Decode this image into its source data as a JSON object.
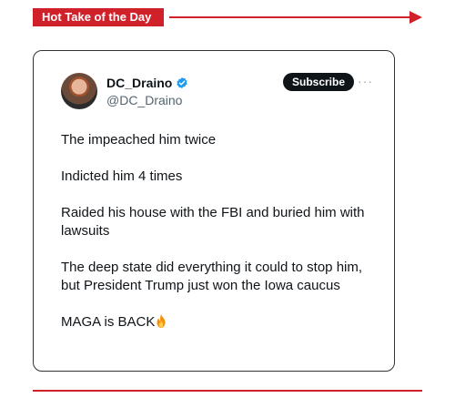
{
  "banner": {
    "label": "Hot Take of the Day"
  },
  "tweet": {
    "display_name": "DC_Draino",
    "handle": "@DC_Draino",
    "subscribe_label": "Subscribe",
    "more_label": "···",
    "paragraphs": [
      "The impeached him twice",
      "Indicted him 4 times",
      "Raided his house with the FBI and buried him with lawsuits",
      "The deep state did everything it could to stop him, but President Trump just won the Iowa caucus",
      "MAGA is BACK"
    ],
    "emoji": "fire-icon"
  },
  "colors": {
    "accent_red": "#d0202a",
    "verified_blue": "#1d9bf0",
    "subscribe_bg": "#0f1419",
    "text_primary": "#0f1419",
    "text_secondary": "#536471"
  }
}
